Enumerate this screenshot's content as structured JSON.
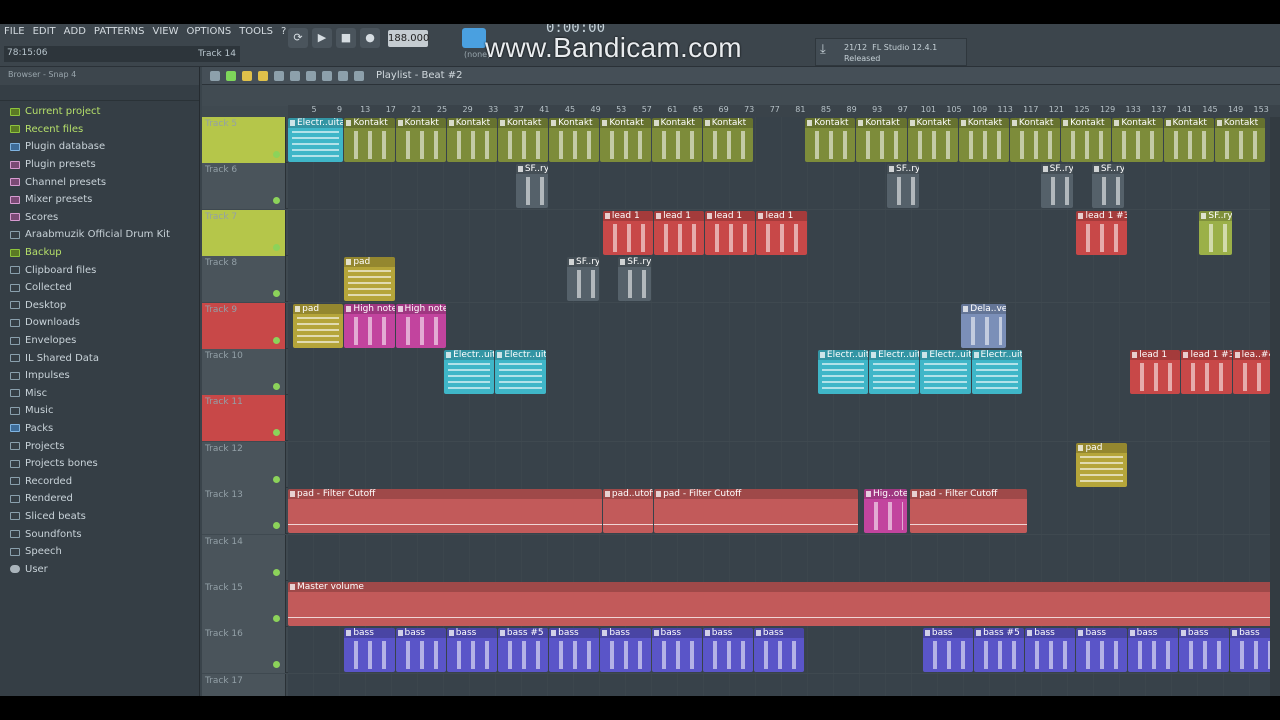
{
  "menu": {
    "items": [
      "FILE",
      "EDIT",
      "ADD",
      "PATTERNS",
      "VIEW",
      "OPTIONS",
      "TOOLS",
      "?"
    ]
  },
  "status": {
    "time": "78:15:06",
    "hint": "Track 14"
  },
  "transport": {
    "bpm": "188.000",
    "song_time": "0:00:00",
    "pattern_none": "(none)"
  },
  "watermark": "www.Bandicam.com",
  "news": {
    "counter": "21/12",
    "title": "FL Studio 12.4.1",
    "sub": "Released"
  },
  "browser": {
    "title": "Browser - Snap 4",
    "items": [
      {
        "label": "Current project",
        "kind": "green"
      },
      {
        "label": "Recent files",
        "kind": "green"
      },
      {
        "label": "Plugin database",
        "kind": "blue"
      },
      {
        "label": "Plugin presets",
        "kind": "pink"
      },
      {
        "label": "Channel presets",
        "kind": "pink"
      },
      {
        "label": "Mixer presets",
        "kind": "pink"
      },
      {
        "label": "Scores",
        "kind": "pink"
      },
      {
        "label": "Araabmuzik Official Drum Kit",
        "kind": ""
      },
      {
        "label": "Backup",
        "kind": "green"
      },
      {
        "label": "Clipboard files",
        "kind": ""
      },
      {
        "label": "Collected",
        "kind": ""
      },
      {
        "label": "Desktop",
        "kind": ""
      },
      {
        "label": "Downloads",
        "kind": ""
      },
      {
        "label": "Envelopes",
        "kind": ""
      },
      {
        "label": "IL Shared Data",
        "kind": ""
      },
      {
        "label": "Impulses",
        "kind": ""
      },
      {
        "label": "Misc",
        "kind": ""
      },
      {
        "label": "Music",
        "kind": ""
      },
      {
        "label": "Packs",
        "kind": "blue"
      },
      {
        "label": "Projects",
        "kind": ""
      },
      {
        "label": "Projects bones",
        "kind": ""
      },
      {
        "label": "Recorded",
        "kind": ""
      },
      {
        "label": "Rendered",
        "kind": ""
      },
      {
        "label": "Sliced beats",
        "kind": ""
      },
      {
        "label": "Soundfonts",
        "kind": ""
      },
      {
        "label": "Speech",
        "kind": ""
      },
      {
        "label": "User",
        "kind": "user"
      }
    ]
  },
  "playlist": {
    "title": "Playlist - Beat #2",
    "ruler": [
      "5",
      "9",
      "13",
      "17",
      "21",
      "25",
      "29",
      "33",
      "37",
      "41",
      "45",
      "49",
      "53",
      "57",
      "61",
      "65",
      "69",
      "73",
      "77",
      "81",
      "85",
      "89",
      "93",
      "97",
      "101",
      "105",
      "109",
      "113",
      "117",
      "121",
      "125",
      "129",
      "133",
      "137",
      "141",
      "145",
      "149",
      "153"
    ],
    "tracks": [
      {
        "name": "Track 5",
        "color": "#b5c64a",
        "clips": [
          {
            "label": "Electr..uitar",
            "color": "#3fb6c8",
            "start": 0,
            "len": 2.2
          },
          {
            "label": "Kontakt",
            "color": "#7d8c3a",
            "start": 2.2,
            "len": 2
          },
          {
            "label": "Kontakt",
            "color": "#7d8c3a",
            "start": 4.2,
            "len": 2
          },
          {
            "label": "Kontakt",
            "color": "#7d8c3a",
            "start": 6.2,
            "len": 2
          },
          {
            "label": "Kontakt",
            "color": "#7d8c3a",
            "start": 8.2,
            "len": 2
          },
          {
            "label": "Kontakt",
            "color": "#7d8c3a",
            "start": 10.2,
            "len": 2
          },
          {
            "label": "Kontakt",
            "color": "#7d8c3a",
            "start": 12.2,
            "len": 2
          },
          {
            "label": "Kontakt",
            "color": "#7d8c3a",
            "start": 14.2,
            "len": 2
          },
          {
            "label": "Kontakt",
            "color": "#7d8c3a",
            "start": 16.2,
            "len": 2
          },
          {
            "label": "Kontakt",
            "color": "#7d8c3a",
            "start": 20.2,
            "len": 2
          },
          {
            "label": "Kontakt",
            "color": "#7d8c3a",
            "start": 22.2,
            "len": 2
          },
          {
            "label": "Kontakt",
            "color": "#7d8c3a",
            "start": 24.2,
            "len": 2
          },
          {
            "label": "Kontakt",
            "color": "#7d8c3a",
            "start": 26.2,
            "len": 2
          },
          {
            "label": "Kontakt",
            "color": "#7d8c3a",
            "start": 28.2,
            "len": 2
          },
          {
            "label": "Kontakt",
            "color": "#7d8c3a",
            "start": 30.2,
            "len": 2
          },
          {
            "label": "Kontakt",
            "color": "#7d8c3a",
            "start": 32.2,
            "len": 2
          },
          {
            "label": "Kontakt",
            "color": "#7d8c3a",
            "start": 34.2,
            "len": 2
          },
          {
            "label": "Kontakt",
            "color": "#7d8c3a",
            "start": 36.2,
            "len": 2
          }
        ]
      },
      {
        "name": "Track 6",
        "color": "#4a545b",
        "clips": [
          {
            "label": "SF..ry",
            "color": "#55616a",
            "start": 8.9,
            "len": 1.3
          },
          {
            "label": "SF..ry",
            "color": "#55616a",
            "start": 23.4,
            "len": 1.3
          },
          {
            "label": "SF..ry",
            "color": "#55616a",
            "start": 29.4,
            "len": 1.3
          },
          {
            "label": "SF..ry",
            "color": "#55616a",
            "start": 31.4,
            "len": 1.3
          }
        ]
      },
      {
        "name": "Track 7",
        "color": "#b5c64a",
        "clips": [
          {
            "label": "lead 1",
            "color": "#c84848",
            "start": 12.3,
            "len": 2
          },
          {
            "label": "lead 1",
            "color": "#c84848",
            "start": 14.3,
            "len": 2
          },
          {
            "label": "lead 1",
            "color": "#c84848",
            "start": 16.3,
            "len": 2
          },
          {
            "label": "lead 1",
            "color": "#c84848",
            "start": 18.3,
            "len": 2
          },
          {
            "label": "lead 1 #3",
            "color": "#c84848",
            "start": 30.8,
            "len": 2
          },
          {
            "label": "SF..ry",
            "color": "#9bb048",
            "start": 35.6,
            "len": 1.3
          }
        ]
      },
      {
        "name": "Track 8",
        "color": "#4a545b",
        "clips": [
          {
            "label": "pad",
            "color": "#b5a53a",
            "start": 2.2,
            "len": 2
          },
          {
            "label": "SF..ry",
            "color": "#55616a",
            "start": 10.9,
            "len": 1.3
          },
          {
            "label": "SF..ry",
            "color": "#55616a",
            "start": 12.9,
            "len": 1.3
          }
        ]
      },
      {
        "name": "Track 9",
        "color": "#c84848",
        "clips": [
          {
            "label": "pad",
            "color": "#b5a53a",
            "start": 0.2,
            "len": 2
          },
          {
            "label": "High note",
            "color": "#c2449e",
            "start": 2.2,
            "len": 2
          },
          {
            "label": "High note",
            "color": "#c2449e",
            "start": 4.2,
            "len": 2
          },
          {
            "label": "Dela..vel",
            "color": "#7b8fb8",
            "start": 26.3,
            "len": 1.8
          }
        ]
      },
      {
        "name": "Track 10",
        "color": "#4a545b",
        "clips": [
          {
            "label": "Electr..uitar",
            "color": "#3fb6c8",
            "start": 6.1,
            "len": 2
          },
          {
            "label": "Electr..uitar",
            "color": "#3fb6c8",
            "start": 8.1,
            "len": 2
          },
          {
            "label": "Electr..uitar",
            "color": "#3fb6c8",
            "start": 20.7,
            "len": 2
          },
          {
            "label": "Electr..uitar",
            "color": "#3fb6c8",
            "start": 22.7,
            "len": 2
          },
          {
            "label": "Electr..uitar",
            "color": "#3fb6c8",
            "start": 24.7,
            "len": 2
          },
          {
            "label": "Electr..uitar",
            "color": "#3fb6c8",
            "start": 26.7,
            "len": 2
          },
          {
            "label": "lead 1",
            "color": "#c84848",
            "start": 32.9,
            "len": 2
          },
          {
            "label": "lead 1 #3",
            "color": "#c84848",
            "start": 34.9,
            "len": 2
          },
          {
            "label": "lea..#4",
            "color": "#c84848",
            "start": 36.9,
            "len": 1.5
          }
        ]
      },
      {
        "name": "Track 11",
        "color": "#c84848",
        "clips": []
      },
      {
        "name": "Track 12",
        "color": "#4a545b",
        "clips": [
          {
            "label": "pad",
            "color": "#b5a53a",
            "start": 30.8,
            "len": 2
          }
        ]
      },
      {
        "name": "Track 13",
        "color": "#4a545b",
        "clips": [
          {
            "label": "pad - Filter Cutoff",
            "color": "#c25a5a",
            "start": 0,
            "len": 12.3
          },
          {
            "label": "pad..utoff",
            "color": "#c25a5a",
            "start": 12.3,
            "len": 2
          },
          {
            "label": "pad - Filter Cutoff",
            "color": "#c25a5a",
            "start": 14.3,
            "len": 8
          },
          {
            "label": "Hig..ote",
            "color": "#c2449e",
            "start": 22.5,
            "len": 1.7
          },
          {
            "label": "pad - Filter Cutoff",
            "color": "#c25a5a",
            "start": 24.3,
            "len": 4.6
          }
        ]
      },
      {
        "name": "Track 14",
        "color": "#4a545b",
        "clips": []
      },
      {
        "name": "Track 15",
        "color": "#4a545b",
        "clips": [
          {
            "label": "Master volume",
            "color": "#c25a5a",
            "start": 0,
            "len": 38.8
          }
        ]
      },
      {
        "name": "Track 16",
        "color": "#4a545b",
        "clips": [
          {
            "label": "bass",
            "color": "#5a55c8",
            "start": 2.2,
            "len": 2
          },
          {
            "label": "bass",
            "color": "#5a55c8",
            "start": 4.2,
            "len": 2
          },
          {
            "label": "bass",
            "color": "#5a55c8",
            "start": 6.2,
            "len": 2
          },
          {
            "label": "bass #5",
            "color": "#5a55c8",
            "start": 8.2,
            "len": 2
          },
          {
            "label": "bass",
            "color": "#5a55c8",
            "start": 10.2,
            "len": 2
          },
          {
            "label": "bass",
            "color": "#5a55c8",
            "start": 12.2,
            "len": 2
          },
          {
            "label": "bass",
            "color": "#5a55c8",
            "start": 14.2,
            "len": 2
          },
          {
            "label": "bass",
            "color": "#5a55c8",
            "start": 16.2,
            "len": 2
          },
          {
            "label": "bass",
            "color": "#5a55c8",
            "start": 18.2,
            "len": 2
          },
          {
            "label": "bass",
            "color": "#5a55c8",
            "start": 24.8,
            "len": 2
          },
          {
            "label": "bass #5",
            "color": "#5a55c8",
            "start": 26.8,
            "len": 2
          },
          {
            "label": "bass",
            "color": "#5a55c8",
            "start": 28.8,
            "len": 2
          },
          {
            "label": "bass",
            "color": "#5a55c8",
            "start": 30.8,
            "len": 2
          },
          {
            "label": "bass",
            "color": "#5a55c8",
            "start": 32.8,
            "len": 2
          },
          {
            "label": "bass",
            "color": "#5a55c8",
            "start": 34.8,
            "len": 2
          },
          {
            "label": "bass",
            "color": "#5a55c8",
            "start": 36.8,
            "len": 2
          }
        ]
      },
      {
        "name": "Track 17",
        "color": "#4a545b",
        "clips": []
      }
    ]
  }
}
